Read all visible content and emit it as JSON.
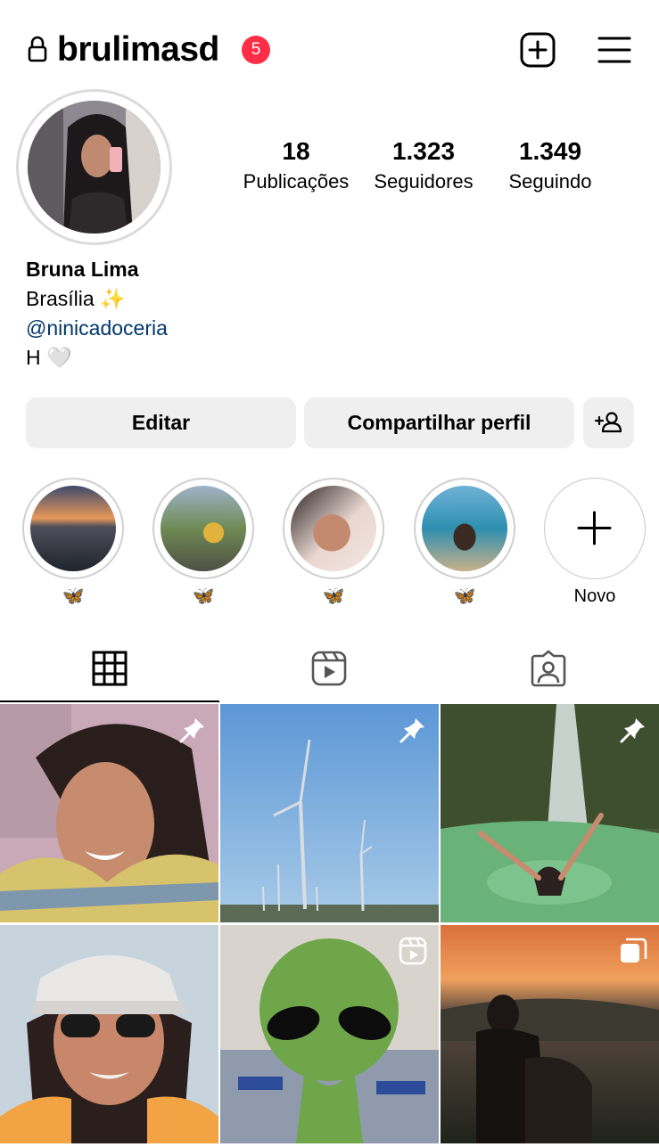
{
  "header": {
    "username": "brulimasd",
    "notification_count": "5",
    "lock_icon": "lock-icon",
    "new_post_icon": "plus-square-icon",
    "menu_icon": "hamburger-menu-icon"
  },
  "profile": {
    "stats": [
      {
        "value": "18",
        "label": "Publicações"
      },
      {
        "value": "1.323",
        "label": "Seguidores"
      },
      {
        "value": "1.349",
        "label": "Seguindo"
      }
    ],
    "name": "Bruna Lima",
    "bio_line1": "Brasília ✨",
    "bio_link": "@ninicadoceria",
    "bio_line3": "H 🤍"
  },
  "actions": {
    "edit_label": "Editar",
    "share_label": "Compartilhar perfil",
    "add_user_icon": "add-person-icon"
  },
  "highlights": [
    {
      "label": "🦋"
    },
    {
      "label": "🦋"
    },
    {
      "label": "🦋"
    },
    {
      "label": "🦋"
    },
    {
      "label": "Novo"
    }
  ],
  "tabs": [
    {
      "icon": "grid-icon",
      "active": true
    },
    {
      "icon": "reels-icon",
      "active": false
    },
    {
      "icon": "tagged-icon",
      "active": false
    }
  ],
  "posts": [
    {
      "badge": "pin-icon"
    },
    {
      "badge": "pin-icon"
    },
    {
      "badge": "pin-icon"
    },
    {
      "badge": ""
    },
    {
      "badge": "reel-icon"
    },
    {
      "badge": "carousel-icon"
    }
  ],
  "colors": {
    "notification_badge": "#ff2d46",
    "link": "#00376b",
    "button_bg": "#efefef"
  }
}
